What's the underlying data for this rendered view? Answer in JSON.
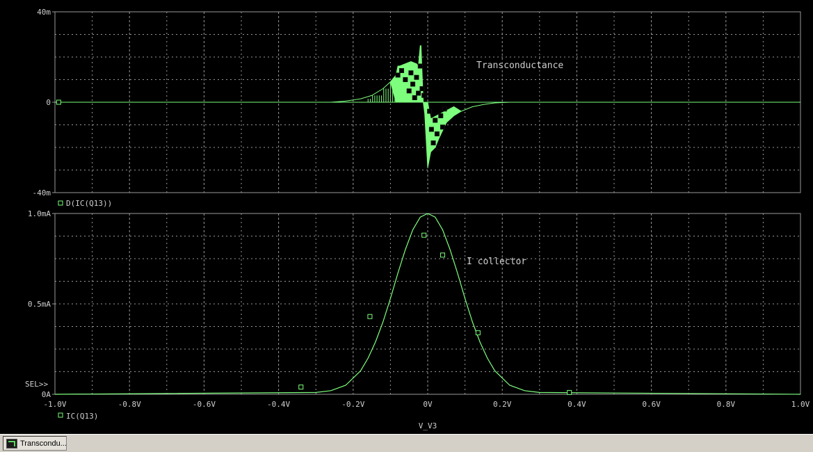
{
  "colors": {
    "background": "#000000",
    "grid": "#9a9a9a",
    "trace": "#7dff7d",
    "text": "#cfcfcf",
    "taskbar": "#d4d0c8"
  },
  "chart_data": [
    {
      "type": "line",
      "title": "",
      "annotation": "Transconductance",
      "legend": [
        "D(IC(Q13))"
      ],
      "legend_position": "bottom-left",
      "xlim": [
        -1.0,
        1.0
      ],
      "ylim": [
        -0.04,
        0.04
      ],
      "yticks": [
        {
          "value": 0.04,
          "label": "40m"
        },
        {
          "value": 0.0,
          "label": "0"
        },
        {
          "value": -0.04,
          "label": "-40m"
        }
      ],
      "grid": true,
      "series": [
        {
          "name": "D(IC(Q13))",
          "x": [
            -0.26,
            -0.22,
            -0.18,
            -0.15,
            -0.12,
            -0.1,
            -0.085,
            -0.08,
            -0.075,
            -0.06,
            -0.045,
            -0.03,
            -0.025,
            -0.02,
            -0.018,
            -0.012,
            -0.008,
            0.0,
            0.008,
            0.02,
            0.03,
            0.05,
            0.07,
            0.09,
            0.12,
            0.15,
            0.18,
            0.22
          ],
          "y": [
            0.0,
            0.0005,
            0.0015,
            0.003,
            0.006,
            0.009,
            0.012,
            0.016,
            0.016,
            0.017,
            0.018,
            0.017,
            0.016,
            0.025,
            0.025,
            0.0,
            -0.005,
            -0.029,
            -0.022,
            -0.02,
            -0.016,
            -0.009,
            -0.006,
            -0.004,
            -0.002,
            -0.001,
            -0.0003,
            0.0
          ],
          "envelope_low": [
            {
              "x": -0.085,
              "y": 0.0
            },
            {
              "x": -0.012,
              "y": 0.0
            },
            {
              "x": 0.0,
              "y": -0.008
            },
            {
              "x": 0.07,
              "y": -0.002
            }
          ],
          "markers": [
            {
              "x": -0.99,
              "y": 0.0
            },
            {
              "x": -0.08,
              "y": 0.012
            },
            {
              "x": -0.07,
              "y": 0.014
            },
            {
              "x": -0.06,
              "y": 0.01
            },
            {
              "x": -0.05,
              "y": 0.005
            },
            {
              "x": -0.045,
              "y": 0.013
            },
            {
              "x": -0.04,
              "y": 0.008
            },
            {
              "x": -0.035,
              "y": 0.002
            },
            {
              "x": -0.03,
              "y": 0.011
            },
            {
              "x": -0.025,
              "y": 0.004
            },
            {
              "x": -0.02,
              "y": 0.016
            },
            {
              "x": -0.015,
              "y": 0.006
            },
            {
              "x": -0.01,
              "y": 0.003
            },
            {
              "x": 0.005,
              "y": -0.004
            },
            {
              "x": 0.01,
              "y": -0.012
            },
            {
              "x": 0.015,
              "y": -0.018
            },
            {
              "x": 0.02,
              "y": -0.008
            },
            {
              "x": 0.025,
              "y": -0.014
            },
            {
              "x": 0.03,
              "y": -0.02
            },
            {
              "x": 0.035,
              "y": -0.006
            },
            {
              "x": 0.04,
              "y": -0.011
            },
            {
              "x": 0.045,
              "y": -0.003
            }
          ]
        }
      ]
    },
    {
      "type": "line",
      "title": "",
      "annotation": "I collector",
      "legend": [
        "IC(Q13)"
      ],
      "legend_position": "bottom-left",
      "selector_label": "SEL>>",
      "xlim": [
        -1.0,
        1.0
      ],
      "ylim": [
        0.0,
        0.001
      ],
      "yticks": [
        {
          "value": 0.001,
          "label": "1.0mA"
        },
        {
          "value": 0.0005,
          "label": "0.5mA"
        },
        {
          "value": 0.0,
          "label": "0A"
        }
      ],
      "xticks": [
        {
          "value": -1.0,
          "label": "-1.0V"
        },
        {
          "value": -0.8,
          "label": "-0.8V"
        },
        {
          "value": -0.6,
          "label": "-0.6V"
        },
        {
          "value": -0.4,
          "label": "-0.4V"
        },
        {
          "value": -0.2,
          "label": "-0.2V"
        },
        {
          "value": 0.0,
          "label": "0V"
        },
        {
          "value": 0.2,
          "label": "0.2V"
        },
        {
          "value": 0.4,
          "label": "0.4V"
        },
        {
          "value": 0.6,
          "label": "0.6V"
        },
        {
          "value": 0.8,
          "label": "0.8V"
        },
        {
          "value": 1.0,
          "label": "1.0V"
        }
      ],
      "xlabel": "V_V3",
      "grid": true,
      "series": [
        {
          "name": "IC(Q13)",
          "x": [
            -1.0,
            -0.3,
            -0.26,
            -0.22,
            -0.18,
            -0.16,
            -0.14,
            -0.12,
            -0.1,
            -0.08,
            -0.06,
            -0.04,
            -0.02,
            0.0,
            0.02,
            0.04,
            0.06,
            0.08,
            0.1,
            0.12,
            0.14,
            0.16,
            0.18,
            0.22,
            0.26,
            0.3,
            1.0
          ],
          "y": [
            0.0,
            1e-05,
            2e-05,
            5e-05,
            0.00013,
            0.0002,
            0.00029,
            0.0004,
            0.00053,
            0.00067,
            0.0008,
            0.00091,
            0.00098,
            0.001,
            0.00098,
            0.00091,
            0.0008,
            0.00067,
            0.00053,
            0.0004,
            0.00029,
            0.0002,
            0.00013,
            5e-05,
            2e-05,
            1e-05,
            0.0
          ],
          "markers": [
            {
              "x": -0.01,
              "y": 0.00088
            },
            {
              "x": 0.04,
              "y": 0.00077
            },
            {
              "x": -0.155,
              "y": 0.00043
            },
            {
              "x": 0.135,
              "y": 0.00034
            },
            {
              "x": -0.34,
              "y": 4e-05
            },
            {
              "x": 0.38,
              "y": 1e-05
            }
          ]
        }
      ]
    }
  ],
  "taskbar": {
    "button_label": "Transcondu..."
  }
}
